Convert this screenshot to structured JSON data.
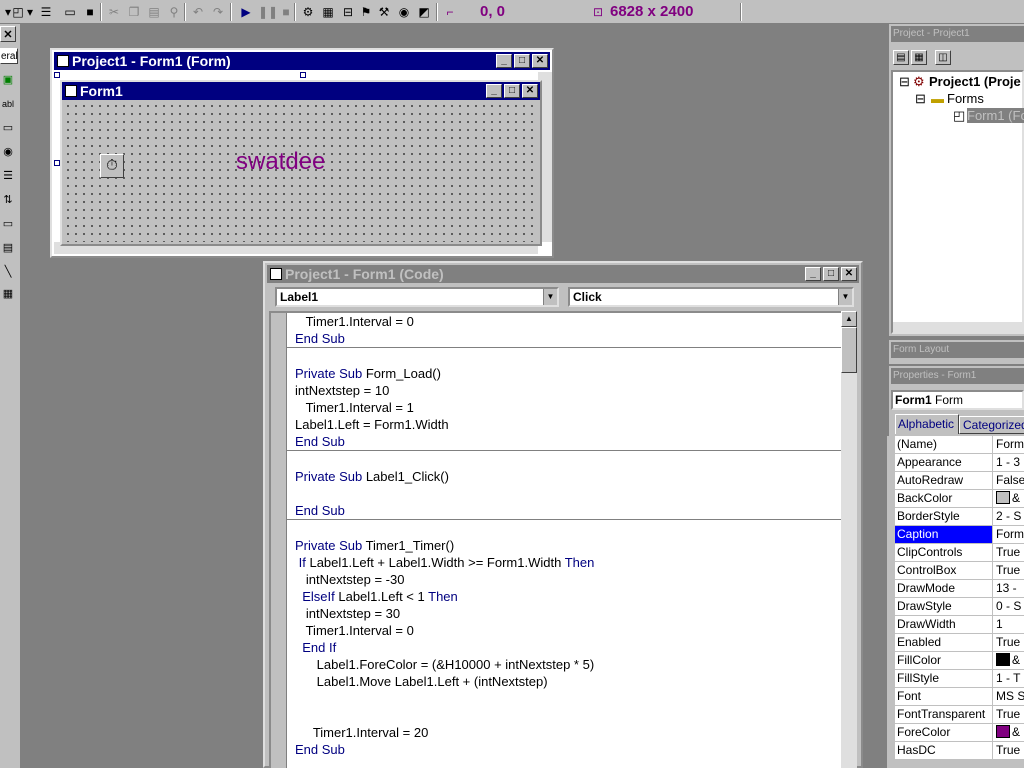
{
  "toolbar": {
    "position_readout": "0, 0",
    "size_readout": "6828 x 2400"
  },
  "toolbox": {
    "labels": [
      "eral",
      "abl"
    ]
  },
  "form_designer": {
    "title": "Project1 - Form1 (Form)",
    "inner_form_title": "Form1",
    "label_caption": "swatdee",
    "label_color": "#800080"
  },
  "code_window": {
    "title": "Project1 - Form1 (Code)",
    "object_combo": "Label1",
    "procedure_combo": "Click",
    "lines": [
      {
        "pre": "   Timer1.Interval = 0",
        "kw": "",
        "post": "",
        "sep": false
      },
      {
        "pre": "",
        "kw": "End Sub",
        "post": "",
        "sep": true
      },
      {
        "pre": "",
        "kw": "",
        "post": "",
        "sep": false
      },
      {
        "pre": "",
        "kw": "Private Sub",
        "post": " Form_Load()",
        "sep": false
      },
      {
        "pre": "intNextstep = 10",
        "kw": "",
        "post": "",
        "sep": false
      },
      {
        "pre": "   Timer1.Interval = 1",
        "kw": "",
        "post": "",
        "sep": false
      },
      {
        "pre": "Label1.Left = Form1.Width",
        "kw": "",
        "post": "",
        "sep": false
      },
      {
        "pre": "",
        "kw": "End Sub",
        "post": "",
        "sep": true
      },
      {
        "pre": "",
        "kw": "",
        "post": "",
        "sep": false
      },
      {
        "pre": "",
        "kw": "Private Sub",
        "post": " Label1_Click()",
        "sep": false
      },
      {
        "pre": "",
        "kw": "",
        "post": "",
        "sep": false
      },
      {
        "pre": "",
        "kw": "End Sub",
        "post": "",
        "sep": true
      },
      {
        "pre": "",
        "kw": "",
        "post": "",
        "sep": false
      },
      {
        "pre": "",
        "kw": "Private Sub",
        "post": " Timer1_Timer()",
        "sep": false
      },
      {
        "pre": " ",
        "kw": "If",
        "post": " Label1.Left + Label1.Width >= Form1.Width ",
        "kw2": "Then",
        "sep": false
      },
      {
        "pre": "   intNextstep = -30",
        "kw": "",
        "post": "",
        "sep": false
      },
      {
        "pre": "  ",
        "kw": "ElseIf",
        "post": " Label1.Left < 1 ",
        "kw2": "Then",
        "sep": false
      },
      {
        "pre": "   intNextstep = 30",
        "kw": "",
        "post": "",
        "sep": false
      },
      {
        "pre": "   Timer1.Interval = 0",
        "kw": "",
        "post": "",
        "sep": false
      },
      {
        "pre": "  ",
        "kw": "End If",
        "post": "",
        "sep": false
      },
      {
        "pre": "      Label1.ForeColor = (&H10000 + intNextstep * 5)",
        "kw": "",
        "post": "",
        "sep": false
      },
      {
        "pre": "      Label1.Move Label1.Left + (intNextstep)",
        "kw": "",
        "post": "",
        "sep": false
      },
      {
        "pre": "",
        "kw": "",
        "post": "",
        "sep": false
      },
      {
        "pre": "",
        "kw": "",
        "post": "",
        "sep": false
      },
      {
        "pre": "     Timer1.Interval = 20",
        "kw": "",
        "post": "",
        "sep": false
      },
      {
        "pre": "",
        "kw": "End Sub",
        "post": "",
        "sep": false
      }
    ]
  },
  "project_explorer": {
    "title": "Project - Project1",
    "root": "Project1 (Proje",
    "folder": "Forms",
    "item": "Form1 (Fo"
  },
  "form_layout": {
    "title": "Form Layout"
  },
  "properties": {
    "title": "Properties - Form1",
    "object_name": "Form1",
    "object_type": " Form",
    "tab_alphabetic": "Alphabetic",
    "tab_categorized": "Categorized",
    "rows": [
      {
        "name": "(Name)",
        "value": "Form",
        "swatch": ""
      },
      {
        "name": "Appearance",
        "value": "1 - 3",
        "swatch": ""
      },
      {
        "name": "AutoRedraw",
        "value": "False",
        "swatch": ""
      },
      {
        "name": "BackColor",
        "value": "&",
        "swatch": "#c0c0c0"
      },
      {
        "name": "BorderStyle",
        "value": "2 - S",
        "swatch": ""
      },
      {
        "name": "Caption",
        "value": "Form",
        "swatch": "",
        "selected": true
      },
      {
        "name": "ClipControls",
        "value": "True",
        "swatch": ""
      },
      {
        "name": "ControlBox",
        "value": "True",
        "swatch": ""
      },
      {
        "name": "DrawMode",
        "value": "13 -",
        "swatch": ""
      },
      {
        "name": "DrawStyle",
        "value": "0 - S",
        "swatch": ""
      },
      {
        "name": "DrawWidth",
        "value": "1",
        "swatch": ""
      },
      {
        "name": "Enabled",
        "value": "True",
        "swatch": ""
      },
      {
        "name": "FillColor",
        "value": "&",
        "swatch": "#000000"
      },
      {
        "name": "FillStyle",
        "value": "1 - T",
        "swatch": ""
      },
      {
        "name": "Font",
        "value": "MS S",
        "swatch": ""
      },
      {
        "name": "FontTransparent",
        "value": "True",
        "swatch": ""
      },
      {
        "name": "ForeColor",
        "value": "&",
        "swatch": "#800080"
      },
      {
        "name": "HasDC",
        "value": "True",
        "swatch": ""
      }
    ]
  }
}
